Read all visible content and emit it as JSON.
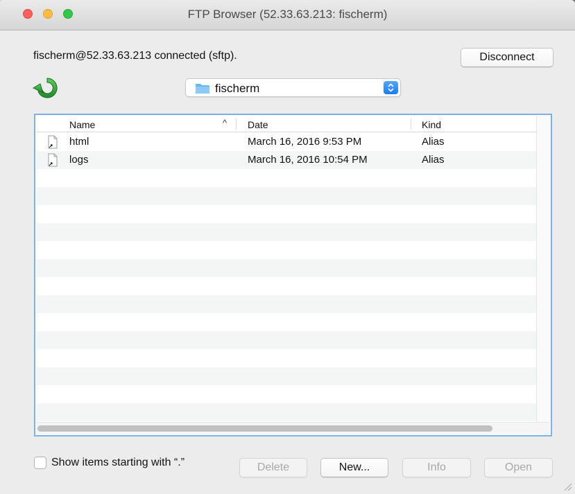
{
  "window": {
    "title": "FTP Browser (52.33.63.213: fischerm)"
  },
  "connection": {
    "status_text": "fischerm@52.33.63.213 connected (sftp).",
    "disconnect_label": "Disconnect"
  },
  "path": {
    "current_folder": "fischerm"
  },
  "table": {
    "columns": {
      "name": "Name",
      "date": "Date",
      "kind": "Kind"
    },
    "sort_indicator": "^",
    "rows": [
      {
        "name": "html",
        "date": "March 16, 2016 9:53 PM",
        "kind": "Alias"
      },
      {
        "name": "logs",
        "date": "March 16, 2016 10:54 PM",
        "kind": "Alias"
      }
    ]
  },
  "footer": {
    "show_hidden_label": "Show items starting with “.”",
    "show_hidden_checked": false,
    "delete_label": "Delete",
    "new_label": "New...",
    "info_label": "Info",
    "open_label": "Open"
  },
  "colors": {
    "accent": "#1a7cf5",
    "refresh_green": "#2f9e3a",
    "list_focus_ring": "#7db1e8"
  },
  "icons": [
    "refresh-icon",
    "folder-icon",
    "popup-stepper-icon",
    "alias-file-icon",
    "sort-ascending-icon",
    "resize-grip-icon"
  ]
}
